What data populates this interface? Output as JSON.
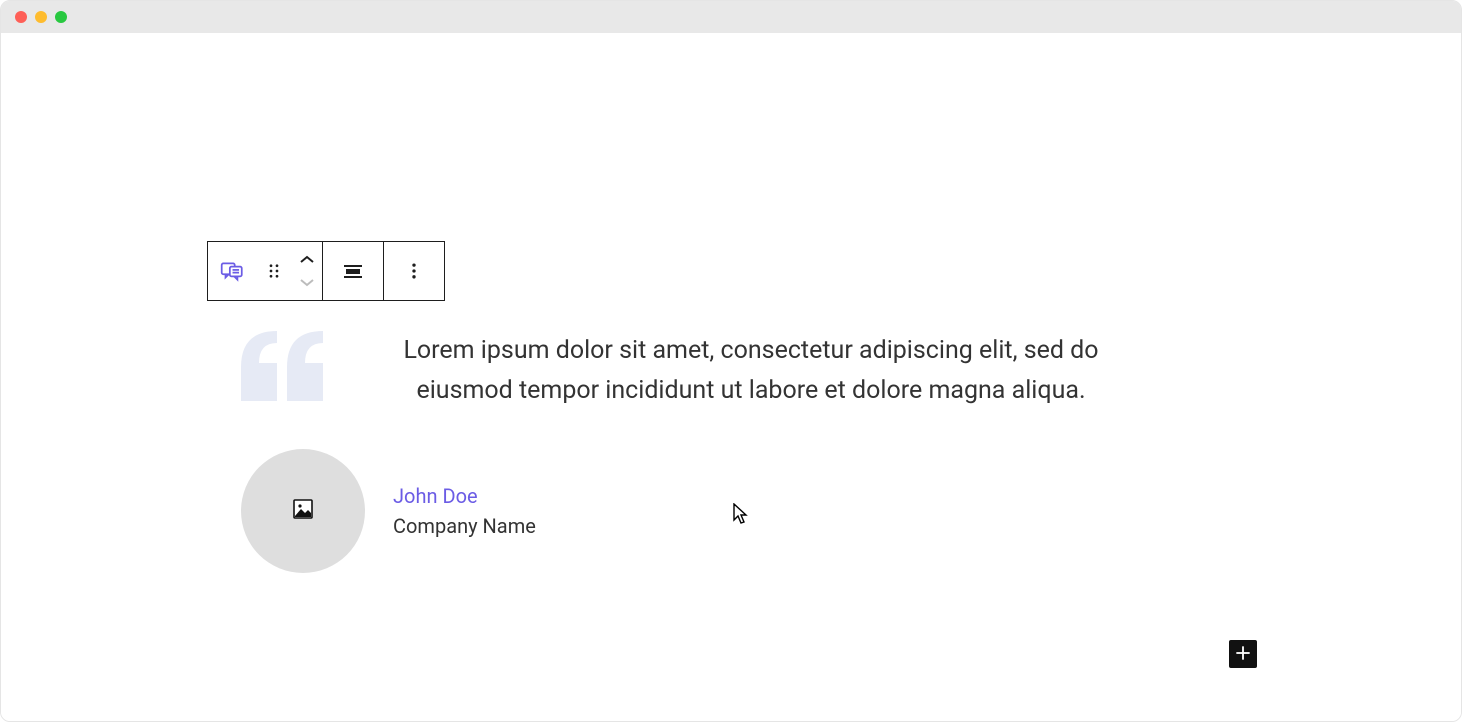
{
  "window": {
    "controls": {
      "close": "close",
      "minimize": "minimize",
      "maximize": "maximize"
    }
  },
  "toolbar": {
    "block_type_icon": "testimonial-block-icon",
    "drag_icon": "drag-handle-icon",
    "move_up_icon": "chevron-up-icon",
    "move_down_icon": "chevron-down-icon",
    "align_icon": "align-icon",
    "more_icon": "more-vertical-icon"
  },
  "testimonial": {
    "quote": "Lorem ipsum dolor sit amet, consectetur adipiscing elit, sed do eiusmod tempor incididunt ut labore et dolore magna aliqua.",
    "author_name": "John Doe",
    "company": "Company Name",
    "avatar_placeholder_icon": "image-placeholder-icon"
  },
  "add_block": {
    "icon": "plus-icon"
  }
}
